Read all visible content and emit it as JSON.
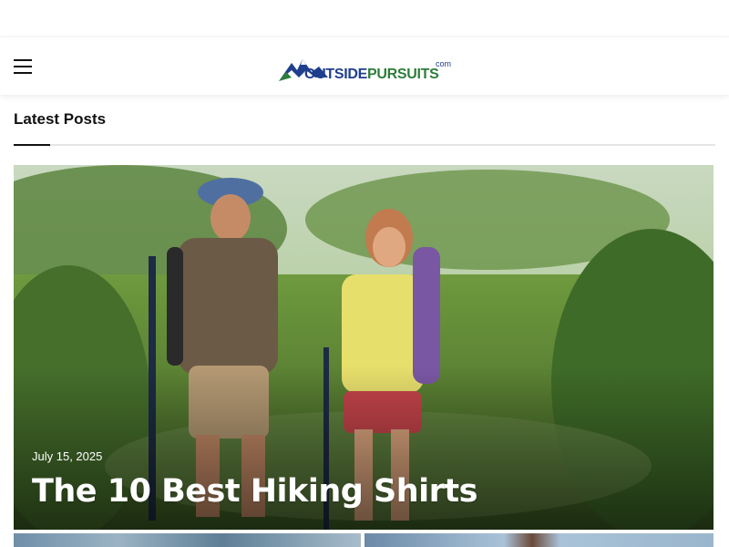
{
  "header": {
    "logo": {
      "part1": "OUTSIDE",
      "part2": "PURSUITS",
      "suffix": "com"
    }
  },
  "section": {
    "title": "Latest Posts"
  },
  "featured_post": {
    "date": "July 15, 2025",
    "title": "The 10 Best Hiking Shirts"
  },
  "icons": {
    "menu": "hamburger-menu-icon",
    "logo": "mountain-logo-icon"
  },
  "colors": {
    "logo_blue": "#1f3f8c",
    "logo_green": "#2e7d3a",
    "accent_dark": "#111111"
  }
}
